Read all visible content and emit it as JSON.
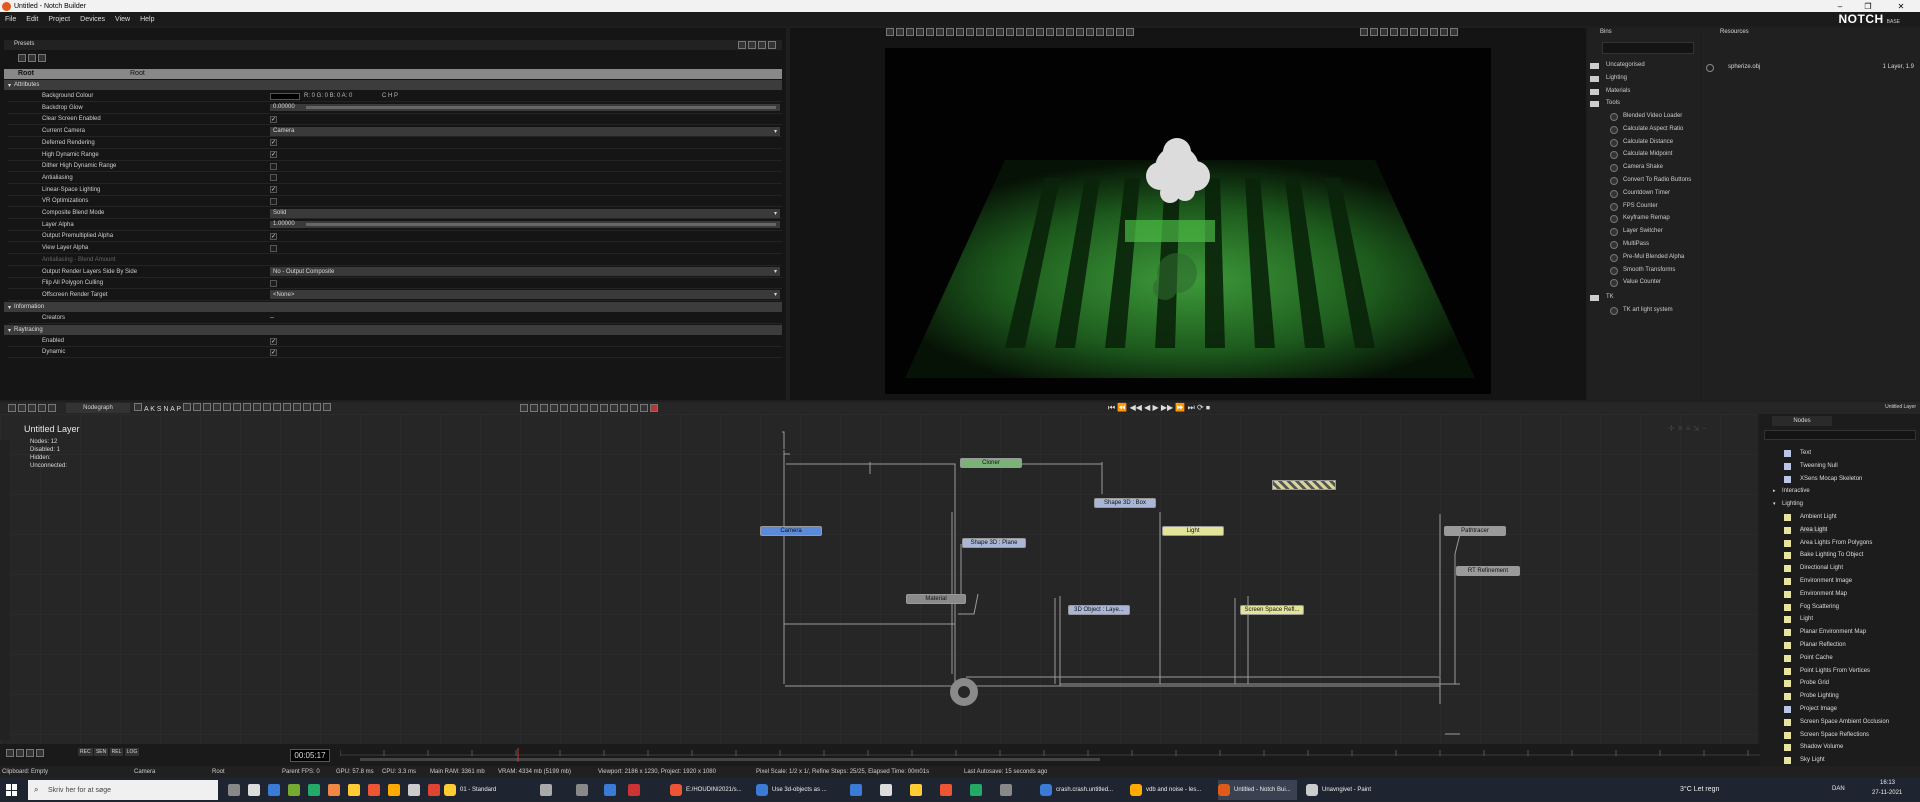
{
  "window": {
    "title": "Untitled - Notch Builder"
  },
  "menu": [
    "File",
    "Edit",
    "Project",
    "Devices",
    "View",
    "Help"
  ],
  "logo": {
    "brand": "NOTCH",
    "edition": "BASE"
  },
  "presets": {
    "tab": "Presets"
  },
  "root": {
    "label": "Root",
    "value": "Root"
  },
  "sections": {
    "attributes": "Attributes",
    "information": "Information",
    "raytracing": "Raytracing"
  },
  "properties": [
    {
      "name": "Background Colour",
      "type": "color",
      "value": "R: 0 G: 0 B: 0 A: 0",
      "extra": "C  H  P"
    },
    {
      "name": "Backdrop Glow",
      "type": "slider",
      "value": "0.00000"
    },
    {
      "name": "Clear Screen Enabled",
      "type": "check",
      "value": "✓"
    },
    {
      "name": "Current Camera",
      "type": "dropdown",
      "value": "Camera"
    },
    {
      "name": "Deferred Rendering",
      "type": "check",
      "value": "✓"
    },
    {
      "name": "High Dynamic Range",
      "type": "check",
      "value": "✓"
    },
    {
      "name": "Dither High Dynamic Range",
      "type": "check",
      "value": ""
    },
    {
      "name": "Antialiasing",
      "type": "check",
      "value": ""
    },
    {
      "name": "Linear-Space Lighting",
      "type": "check",
      "value": "✓"
    },
    {
      "name": "VR Optimizations",
      "type": "check",
      "value": ""
    },
    {
      "name": "Composite Blend Mode",
      "type": "dropdown",
      "value": "Solid"
    },
    {
      "name": "Layer Alpha",
      "type": "slider",
      "value": "1.00000"
    },
    {
      "name": "Output Premultiplied Alpha",
      "type": "check",
      "value": "✓"
    },
    {
      "name": "View Layer Alpha",
      "type": "check",
      "value": ""
    },
    {
      "name": "Antialiasing - Blend Amount",
      "type": "dim",
      "value": ""
    },
    {
      "name": "Output Render Layers Side By Side",
      "type": "dropdown",
      "value": "No - Output Composite"
    },
    {
      "name": "Flip All Polygon Culling",
      "type": "check",
      "value": ""
    },
    {
      "name": "Offscreen Render Target",
      "type": "dropdown",
      "value": "<None>"
    }
  ],
  "information": [
    {
      "name": "Creators",
      "value": "--"
    }
  ],
  "raytracing": [
    {
      "name": "Enabled",
      "value": "✓"
    },
    {
      "name": "Dynamic",
      "value": "✓"
    }
  ],
  "bins": {
    "title": "Bins",
    "folders": [
      "Uncategorised",
      "Lighting",
      "Materials",
      "Tools"
    ],
    "tools": [
      "Blended Video Loader",
      "Calculate Aspect Ratio",
      "Calculate Distance",
      "Calculate Midpoint",
      "Camera Shake",
      "Convert To Radio Buttons",
      "Countdown Timer",
      "FPS Counter",
      "Keyframe Remap",
      "Layer Switcher",
      "MultiPass",
      "Pre-Mul Blended Alpha",
      "Smooth Transforms",
      "Value Counter"
    ],
    "folder2": "TK",
    "tk": [
      "TK art light system"
    ]
  },
  "resources": {
    "title": "Resources",
    "file": "spherize.obj",
    "info": "1 Layer, 1.9"
  },
  "nodegraph": {
    "tab": "Nodegraph",
    "tools": [
      "A",
      "K",
      "S",
      "N",
      "A",
      "P"
    ],
    "title": "Untitled   Layer",
    "stats": [
      "Nodes:  12",
      "Disabled:  1",
      "Hidden:",
      "Unconnected:"
    ],
    "nodes": [
      {
        "label": "Cloner",
        "color": "#7ab27a"
      },
      {
        "label": "Shape 3D : Box",
        "color": "#a9b6d6"
      },
      {
        "label": "Camera",
        "color": "#5b8ad9"
      },
      {
        "label": "Shape 3D : Plane",
        "color": "#a9b6d6"
      },
      {
        "label": "Light",
        "color": "#e3e39a"
      },
      {
        "label": "Pathtracer",
        "color": "#9a9a9a"
      },
      {
        "label": "RT Refinement",
        "color": "#9a9a9a"
      },
      {
        "label": "Material",
        "color": "#8a8a8a"
      },
      {
        "label": "3D Object : Laye...",
        "color": "#a9b6d6"
      },
      {
        "label": "Screen Space Refl...",
        "color": "#e3e39a"
      }
    ]
  },
  "layer_label": "Untitled Layer",
  "nodes_panel": {
    "tab": "Nodes",
    "items": [
      {
        "label": "Text",
        "type": "b"
      },
      {
        "label": "Tweening Null",
        "type": "b"
      },
      {
        "label": "XSens Mocap Skeleton",
        "type": "b"
      },
      {
        "label": "Interactive",
        "type": "cat",
        "arrow": "▸"
      },
      {
        "label": "Lighting",
        "type": "cat",
        "arrow": "▾"
      },
      {
        "label": "Ambient Light",
        "type": "y"
      },
      {
        "label": "Area Light",
        "type": "y"
      },
      {
        "label": "Area Lights From Polygons",
        "type": "y"
      },
      {
        "label": "Bake Lighting To Object",
        "type": "y"
      },
      {
        "label": "Directional Light",
        "type": "y"
      },
      {
        "label": "Environment Image",
        "type": "y"
      },
      {
        "label": "Environment Map",
        "type": "y"
      },
      {
        "label": "Fog Scattering",
        "type": "y"
      },
      {
        "label": "Light",
        "type": "y"
      },
      {
        "label": "Planar Environment Map",
        "type": "y"
      },
      {
        "label": "Planar Reflection",
        "type": "y"
      },
      {
        "label": "Point Cache",
        "type": "y"
      },
      {
        "label": "Point Lights From Vertices",
        "type": "y"
      },
      {
        "label": "Probe Grid",
        "type": "y"
      },
      {
        "label": "Probe Lighting",
        "type": "y"
      },
      {
        "label": "Project Image",
        "type": "b"
      },
      {
        "label": "Screen Space Ambient Occlusion",
        "type": "y"
      },
      {
        "label": "Screen Space Reflections",
        "type": "y"
      },
      {
        "label": "Shadow Volume",
        "type": "y"
      },
      {
        "label": "Sky Light",
        "type": "y"
      }
    ]
  },
  "timeline": {
    "timecode": "00:05:17",
    "buttons": [
      "REC",
      "SEN",
      "REL",
      "LOG"
    ]
  },
  "status": {
    "clipboard": "Clipboard: Empty",
    "camera": "Camera",
    "root": "Root",
    "parent": "Parent  FPS: 0",
    "gpu": "GPU: 57.8 ms",
    "cpu": "CPU: 3.3 ms",
    "ram": "Main RAM: 3361 mb",
    "vram": "VRAM: 4334 mb (5199 mb)",
    "viewport": "Viewport: 2186 x 1230, Project: 1920 x 1080",
    "pixel": "Pixel Scale: 1/2 x 1/, Refine Steps: 25/25, Elapsed Time: 00m01s",
    "autosave": "Last Autosave: 15 seconds ago"
  },
  "taskbar": {
    "search_placeholder": "Skriv her for at søge",
    "apps": [
      "01 - Standard",
      "E:/HOUDINI2021/s...",
      "Use 3d-objects as ...",
      "crash.crash.untitled...",
      "vdb and noise - les...",
      "Untitled - Notch Bui...",
      "Unavngivet - Paint"
    ],
    "weather": "3°C  Let regn",
    "lang": "DAN",
    "time": "16:13",
    "date": "27-11-2021"
  }
}
